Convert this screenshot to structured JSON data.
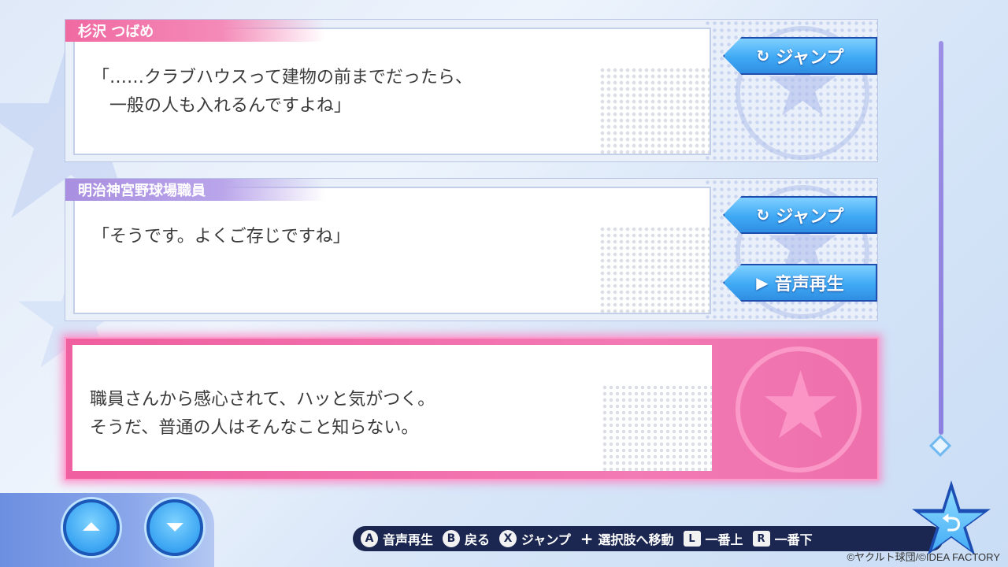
{
  "entries": [
    {
      "speaker": "杉沢 つばめ",
      "text": "「……クラブハウスって建物の前までだったら、\n　一般の人も入れるんですよね」",
      "buttons": [
        {
          "icon": "↻",
          "label": "ジャンプ"
        }
      ]
    },
    {
      "speaker": "明治神宮野球場職員",
      "text": "「そうです。よくご存じですね」",
      "buttons": [
        {
          "icon": "↻",
          "label": "ジャンプ"
        },
        {
          "icon": "▶",
          "label": "音声再生"
        }
      ]
    },
    {
      "speaker": "",
      "text": "職員さんから感心されて、ハッと気がつく。\nそうだ、普通の人はそんなこと知らない。"
    }
  ],
  "nav": {
    "top_glyph": "⏶",
    "bottom_glyph": "⏷"
  },
  "hints": [
    {
      "key": "A",
      "label": "音声再生"
    },
    {
      "key": "B",
      "label": "戻る"
    },
    {
      "key": "X",
      "label": "ジャンプ"
    },
    {
      "key": "+",
      "label": "選択肢へ移動"
    },
    {
      "key": "L",
      "label": "一番上"
    },
    {
      "key": "R",
      "label": "一番下"
    }
  ],
  "back_glyph": "⮌",
  "copyright": "©ヤクルト球団/©IDEA FACTORY",
  "colors": {
    "accent_pink": "#f06aa2",
    "accent_purple": "#a98fe0",
    "button_blue": "#3fa9f5",
    "hint_bar": "#1b2750"
  }
}
